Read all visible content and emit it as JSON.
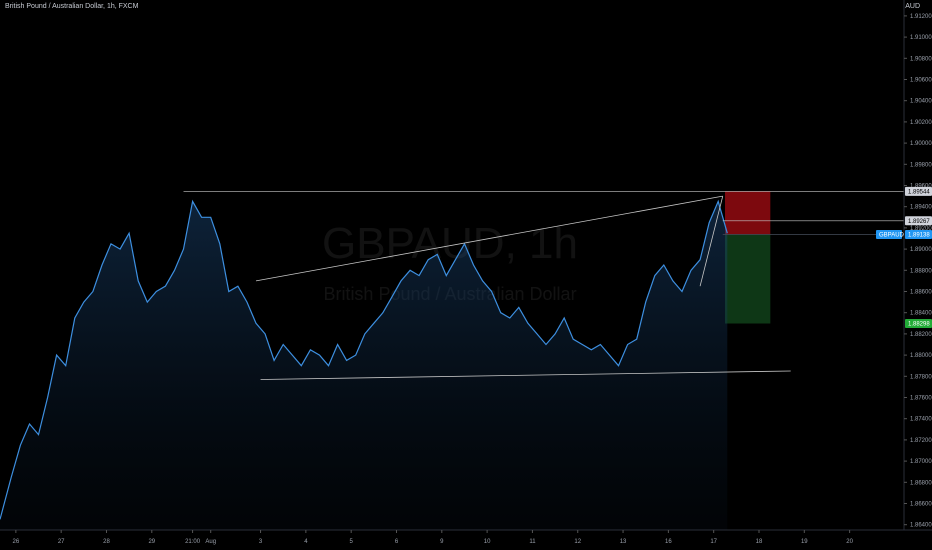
{
  "header": {
    "title": "British Pound / Australian Dollar, 1h, FXCM",
    "currency": "AUD"
  },
  "watermark": {
    "symbol": "GBPAUD, 1h",
    "description": "British Pound / Australian Dollar"
  },
  "chart_data": {
    "type": "area",
    "ylim": [
      1.8635,
      1.9135
    ],
    "y_ticks": [
      "1.91200",
      "1.91000",
      "1.90800",
      "1.90600",
      "1.90400",
      "1.90200",
      "1.90000",
      "1.89800",
      "1.89600",
      "1.89400",
      "1.89200",
      "1.89000",
      "1.88800",
      "1.88600",
      "1.88400",
      "1.88200",
      "1.88000",
      "1.87800",
      "1.87600",
      "1.87400",
      "1.87200",
      "1.87000",
      "1.86800",
      "1.86600",
      "1.86400"
    ],
    "x_ticks": [
      {
        "label": "26",
        "x": 0
      },
      {
        "label": "27",
        "x": 1
      },
      {
        "label": "28",
        "x": 2
      },
      {
        "label": "29",
        "x": 3
      },
      {
        "label": "21:00",
        "x": 3.9
      },
      {
        "label": "Aug",
        "x": 4.3
      },
      {
        "label": "3",
        "x": 5.4
      },
      {
        "label": "4",
        "x": 6.4
      },
      {
        "label": "5",
        "x": 7.4
      },
      {
        "label": "6",
        "x": 8.4
      },
      {
        "label": "9",
        "x": 9.4
      },
      {
        "label": "10",
        "x": 10.4
      },
      {
        "label": "11",
        "x": 11.4
      },
      {
        "label": "12",
        "x": 12.4
      },
      {
        "label": "13",
        "x": 13.4
      },
      {
        "label": "16",
        "x": 14.4
      },
      {
        "label": "17",
        "x": 15.4
      },
      {
        "label": "18",
        "x": 16.4
      },
      {
        "label": "19",
        "x": 17.4
      },
      {
        "label": "20",
        "x": 18.4
      }
    ],
    "x_range": [
      -0.35,
      19.6
    ],
    "series": [
      {
        "x": [
          -0.35,
          -0.1,
          0.1,
          0.3,
          0.5,
          0.7,
          0.9,
          1.1,
          1.3,
          1.5,
          1.7,
          1.9,
          2.1,
          2.3,
          2.5,
          2.7,
          2.9,
          3.1,
          3.3,
          3.5,
          3.7,
          3.9,
          4.1,
          4.3,
          4.5,
          4.7,
          4.9,
          5.1,
          5.3,
          5.5,
          5.7,
          5.9,
          6.1,
          6.3,
          6.5,
          6.7,
          6.9,
          7.1,
          7.3,
          7.5,
          7.7,
          7.9,
          8.1,
          8.3,
          8.5,
          8.7,
          8.9,
          9.1,
          9.3,
          9.5,
          9.7,
          9.9,
          10.1,
          10.3,
          10.5,
          10.7,
          10.9,
          11.1,
          11.3,
          11.5,
          11.7,
          11.9,
          12.1,
          12.3,
          12.5,
          12.7,
          12.9,
          13.1,
          13.3,
          13.5,
          13.7,
          13.9,
          14.1,
          14.3,
          14.5,
          14.7,
          14.9,
          15.1,
          15.3,
          15.5,
          15.7
        ],
        "values": [
          1.8645,
          1.8685,
          1.8715,
          1.8735,
          1.8725,
          1.876,
          1.88,
          1.879,
          1.8835,
          1.885,
          1.886,
          1.8885,
          1.8905,
          1.89,
          1.8915,
          1.887,
          1.885,
          1.886,
          1.8865,
          1.888,
          1.89,
          1.8945,
          1.893,
          1.893,
          1.8905,
          1.886,
          1.8865,
          1.885,
          1.883,
          1.882,
          1.8795,
          1.881,
          1.88,
          1.879,
          1.8805,
          1.88,
          1.879,
          1.881,
          1.8795,
          1.88,
          1.882,
          1.883,
          1.884,
          1.8855,
          1.887,
          1.888,
          1.8875,
          1.889,
          1.8895,
          1.8875,
          1.889,
          1.8905,
          1.8885,
          1.887,
          1.886,
          1.884,
          1.8835,
          1.8845,
          1.883,
          1.882,
          1.881,
          1.882,
          1.8835,
          1.8815,
          1.881,
          1.8805,
          1.881,
          1.88,
          1.879,
          1.881,
          1.8815,
          1.885,
          1.8875,
          1.8885,
          1.887,
          1.886,
          1.888,
          1.889,
          1.8925,
          1.8945,
          1.8915
        ]
      }
    ],
    "horizontal_lines": [
      1.89544,
      1.89267,
      1.89138
    ],
    "trendlines": [
      {
        "from": [
          5.3,
          1.887
        ],
        "to": [
          15.6,
          1.895
        ]
      },
      {
        "from": [
          5.4,
          1.8777
        ],
        "to": [
          17.1,
          1.8785
        ]
      },
      {
        "from": [
          15.1,
          1.8865
        ],
        "to": [
          15.6,
          1.895
        ]
      }
    ],
    "risk_box": {
      "x0": 15.65,
      "x1": 16.65,
      "stop": 1.89544,
      "entry": 1.89138,
      "target": 1.88298
    },
    "price_tags": [
      {
        "label": "1.89544",
        "value": 1.89544,
        "bg": "#d1d4dc",
        "fg": "#000000"
      },
      {
        "label": "1.89267",
        "value": 1.89267,
        "bg": "#d1d4dc",
        "fg": "#000000"
      },
      {
        "label": "1.89138",
        "value": 1.89138,
        "bg": "#2196f3",
        "fg": "#ffffff"
      },
      {
        "label": "1.88298",
        "value": 1.88298,
        "bg": "#22ab37",
        "fg": "#ffffff"
      }
    ],
    "symbol_tag": "GBPAUD"
  },
  "colors": {
    "line": "#3d8fe0",
    "risk": "#8b0a10",
    "reward": "#0f3d18",
    "hline": "#c8c8c8"
  }
}
